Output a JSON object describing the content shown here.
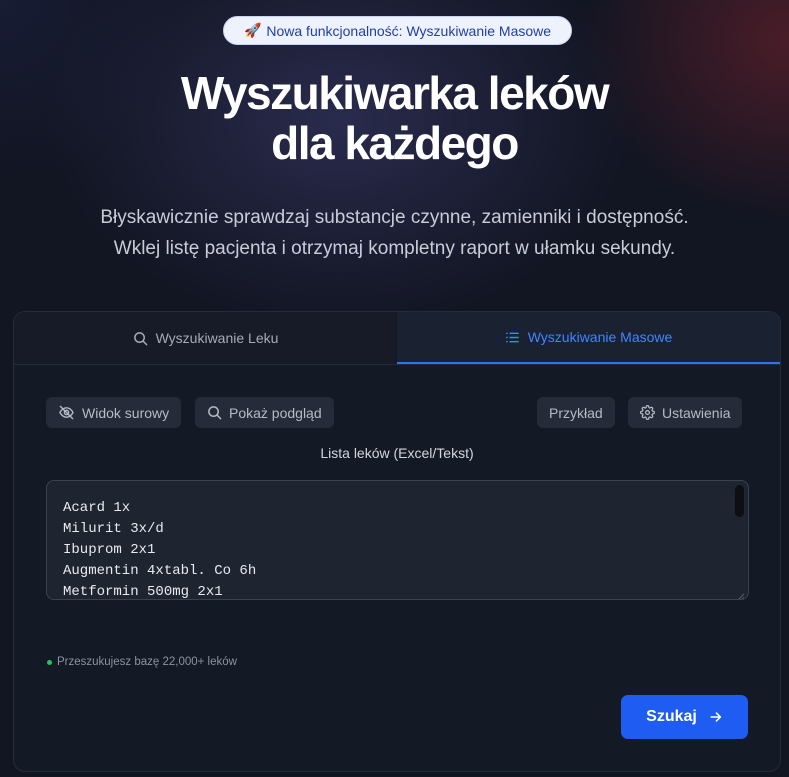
{
  "badge": {
    "emoji": "🚀",
    "text": "Nowa funkcjonalność: Wyszukiwanie Masowe"
  },
  "hero": {
    "title_line1": "Wyszukiwarka leków",
    "title_line2": "dla każdego",
    "subtitle_line1": "Błyskawicznie sprawdzaj substancje czynne, zamienniki i dostępność.",
    "subtitle_line2": "Wklej listę pacjenta i otrzymaj kompletny raport w ułamku sekundy."
  },
  "tabs": [
    {
      "label": "Wyszukiwanie Leku",
      "icon": "search-icon",
      "active": false
    },
    {
      "label": "Wyszukiwanie Masowe",
      "icon": "list-icon",
      "active": true
    }
  ],
  "toolbar": {
    "raw_view_label": "Widok surowy",
    "preview_label": "Pokaż podgląd",
    "example_label": "Przykład",
    "settings_label": "Ustawienia"
  },
  "drug_list": {
    "label": "Lista leków (Excel/Tekst)",
    "value": "Acard 1x\nMilurit 3x/d\nIbuprom 2x1\nAugmentin 4xtabl. Co 6h\nMetformin 500mg 2x1"
  },
  "status": {
    "text": "Przeszukujesz bazę 22,000+ leków"
  },
  "submit": {
    "label": "Szukaj"
  },
  "colors": {
    "accent": "#1f5cf2",
    "active_tab": "#3f86ff",
    "status_dot": "#22c55e",
    "badge_bg": "#eef2fd",
    "background": "#121522"
  }
}
